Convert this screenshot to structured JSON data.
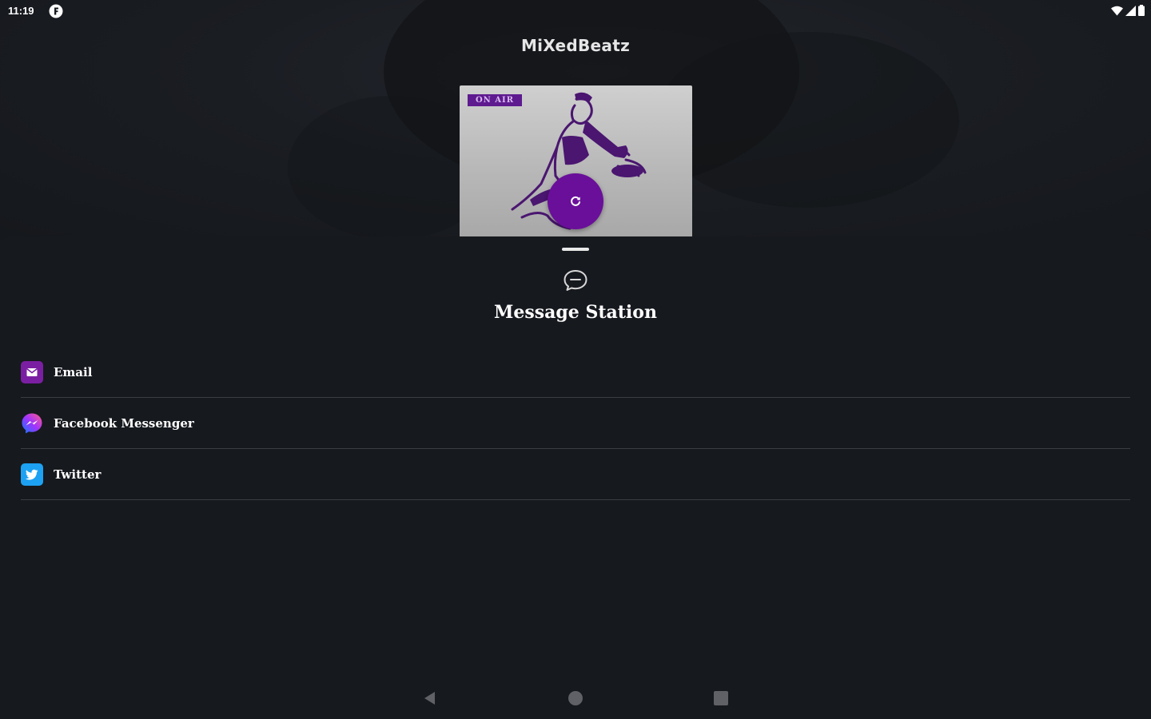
{
  "status_bar": {
    "time": "11:19",
    "app_icon": "app-notification-icon",
    "icons": [
      "wifi-icon",
      "cell-signal-icon",
      "battery-icon"
    ]
  },
  "header": {
    "app_title": "MiXedBeatz"
  },
  "now_playing": {
    "badge": "ON AIR",
    "play_button_icon": "refresh-icon",
    "accent_color": "#6a0f9a"
  },
  "sheet": {
    "icon": "chat-bubble-icon",
    "title": "Message Station",
    "items": [
      {
        "label": "Email",
        "icon": "email-icon",
        "color": "#7b1fa2"
      },
      {
        "label": "Facebook Messenger",
        "icon": "messenger-icon",
        "color": "#a033ff"
      },
      {
        "label": "Twitter",
        "icon": "twitter-icon",
        "color": "#1da1f2"
      }
    ]
  },
  "nav_bar": {
    "icons": [
      "back-icon",
      "home-icon",
      "recents-icon"
    ]
  }
}
